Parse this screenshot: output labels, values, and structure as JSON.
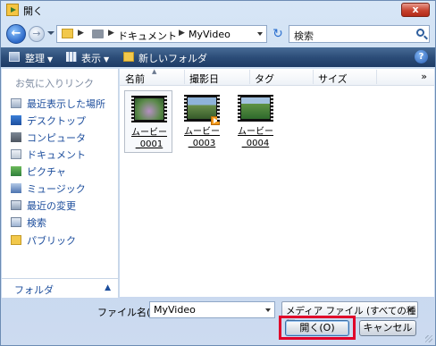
{
  "window": {
    "title": "開く",
    "close_label": "x"
  },
  "nav": {
    "breadcrumbs": [
      "ドキュメント",
      "MyVideo"
    ],
    "search_placeholder": "検索"
  },
  "toolbar": {
    "organize": "整理",
    "views": "表示",
    "new_folder": "新しいフォルダ",
    "help": "?"
  },
  "sidebar": {
    "favorites_header": "お気に入りリンク",
    "items": [
      {
        "label": "最近表示した場所",
        "icon": "recent-places-icon"
      },
      {
        "label": "デスクトップ",
        "icon": "desktop-icon"
      },
      {
        "label": "コンピュータ",
        "icon": "computer-icon"
      },
      {
        "label": "ドキュメント",
        "icon": "documents-icon"
      },
      {
        "label": "ピクチャ",
        "icon": "pictures-icon"
      },
      {
        "label": "ミュージック",
        "icon": "music-icon"
      },
      {
        "label": "最近の変更",
        "icon": "recently-changed-icon"
      },
      {
        "label": "検索",
        "icon": "searches-icon"
      },
      {
        "label": "パブリック",
        "icon": "public-folder-icon"
      }
    ],
    "folders_label": "フォルダ"
  },
  "columns": [
    "名前",
    "撮影日",
    "タグ",
    "サイズ"
  ],
  "more_columns": "»",
  "files": [
    {
      "line1": "ムービー",
      "line2": "_0001",
      "selected": true
    },
    {
      "line1": "ムービー",
      "line2": "_0003",
      "selected": false
    },
    {
      "line1": "ムービー",
      "line2": "_0004",
      "selected": false
    }
  ],
  "bottom": {
    "filename_label": "ファイル名(N):",
    "filename_value": "MyVideo",
    "filetype_value": "メディア ファイル (すべての種類)",
    "open_label": "開く(O)",
    "cancel_label": "キャンセル"
  },
  "colors": {
    "highlight": "#e0002a",
    "toolbar": "#2c4d78",
    "link": "#1c4d9c"
  }
}
